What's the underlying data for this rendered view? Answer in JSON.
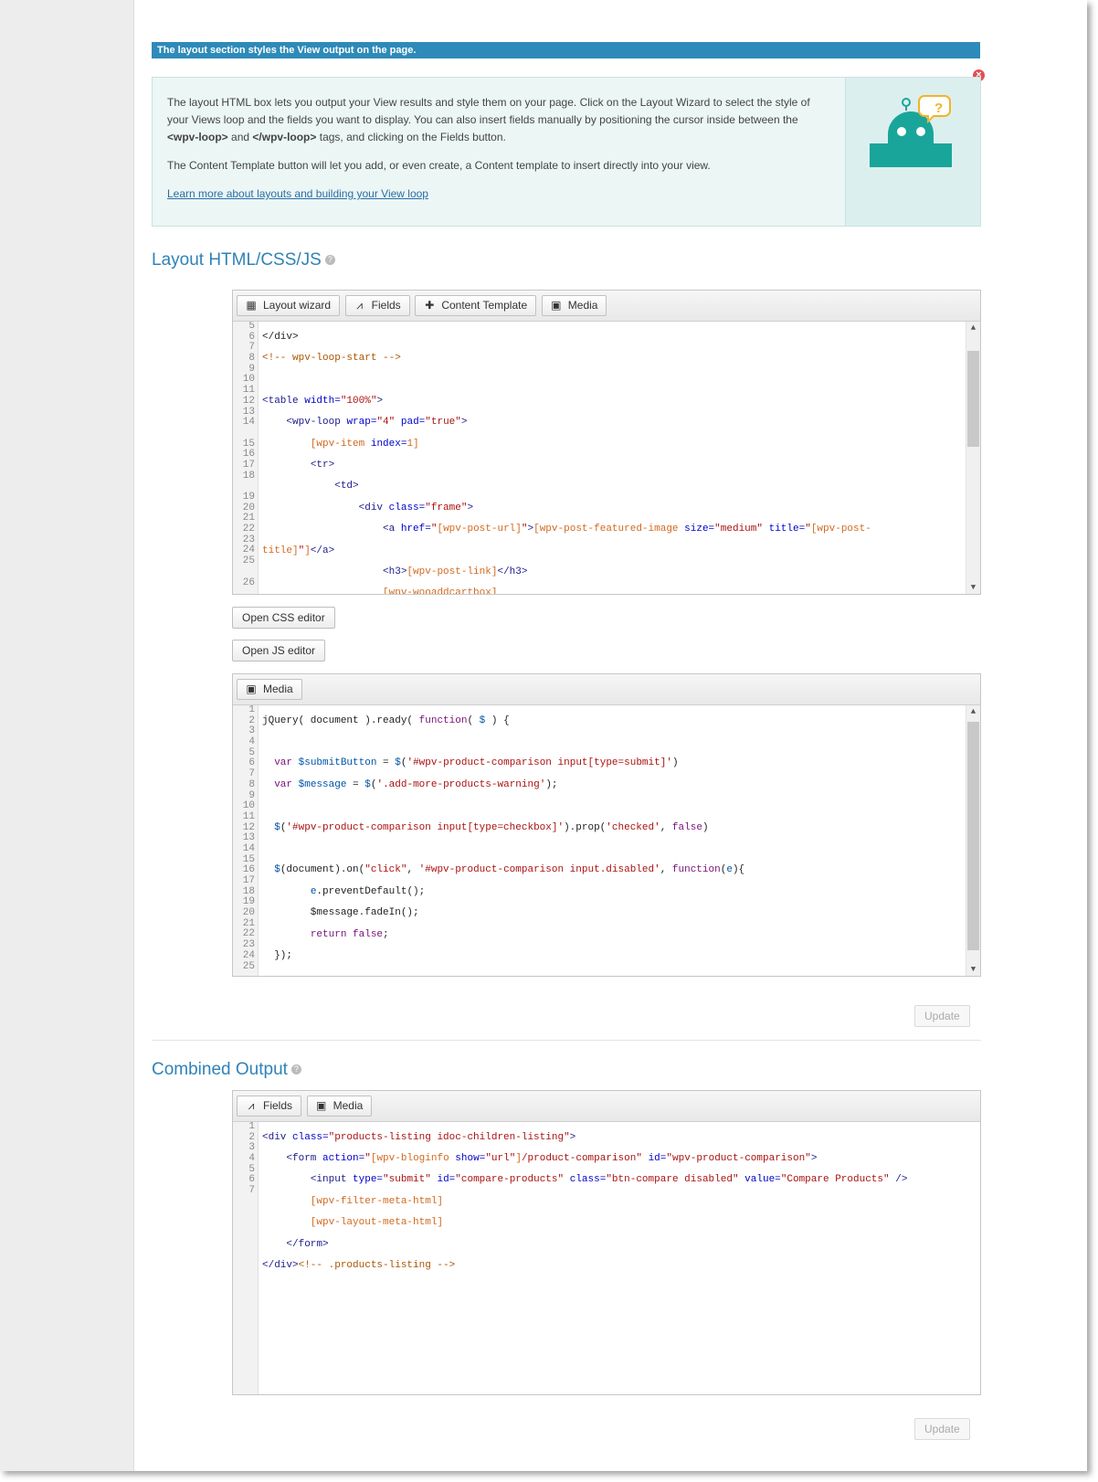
{
  "banner": {
    "text": "The layout section styles the View output on the page."
  },
  "info": {
    "p1_a": "The layout HTML box lets you output your View results and style them on your page. Click on the Layout Wizard to select the style of your Views loop and the fields you want to display. You can also insert fields manually by positioning the cursor inside between the ",
    "p1_tag1": "<wpv-loop>",
    "p1_and": " and ",
    "p1_tag2": "</wpv-loop>",
    "p1_b": " tags, and clicking on the Fields button.",
    "p2": "The Content Template button will let you add, or even create, a Content template to insert directly into your view.",
    "link": "Learn more about layouts and building your View loop"
  },
  "layout_section": {
    "title": "Layout HTML/CSS/JS",
    "toolbar": {
      "layout_wizard": "Layout wizard",
      "fields": "Fields",
      "content_template": "Content Template",
      "media": "Media"
    },
    "line_numbers": [
      "5",
      "6",
      "7",
      "8",
      "9",
      "10",
      "11",
      "12",
      "13",
      "14",
      "",
      "15",
      "16",
      "17",
      "18",
      "",
      "19",
      "20",
      "21",
      "22",
      "23",
      "24",
      "25",
      "",
      "26"
    ],
    "open_css": "Open CSS editor",
    "open_js": "Open JS editor",
    "js_toolbar": {
      "media": "Media"
    },
    "js_line_numbers": [
      "1",
      "2",
      "3",
      "4",
      "5",
      "6",
      "7",
      "8",
      "9",
      "10",
      "11",
      "12",
      "13",
      "14",
      "15",
      "16",
      "17",
      "18",
      "19",
      "20",
      "21",
      "22",
      "23",
      "24",
      "25"
    ],
    "update": "Update"
  },
  "combined_section": {
    "title": "Combined Output",
    "toolbar": {
      "fields": "Fields",
      "media": "Media"
    },
    "line_numbers": [
      "1",
      "2",
      "3",
      "4",
      "5",
      "6",
      "7"
    ],
    "update": "Update"
  },
  "icons": {
    "close": "close-icon",
    "help": "help-icon",
    "grid": "grid-icon",
    "fields": "fields-icon",
    "plus": "plus-icon",
    "media": "image-icon",
    "robot": "robot-illustration"
  }
}
